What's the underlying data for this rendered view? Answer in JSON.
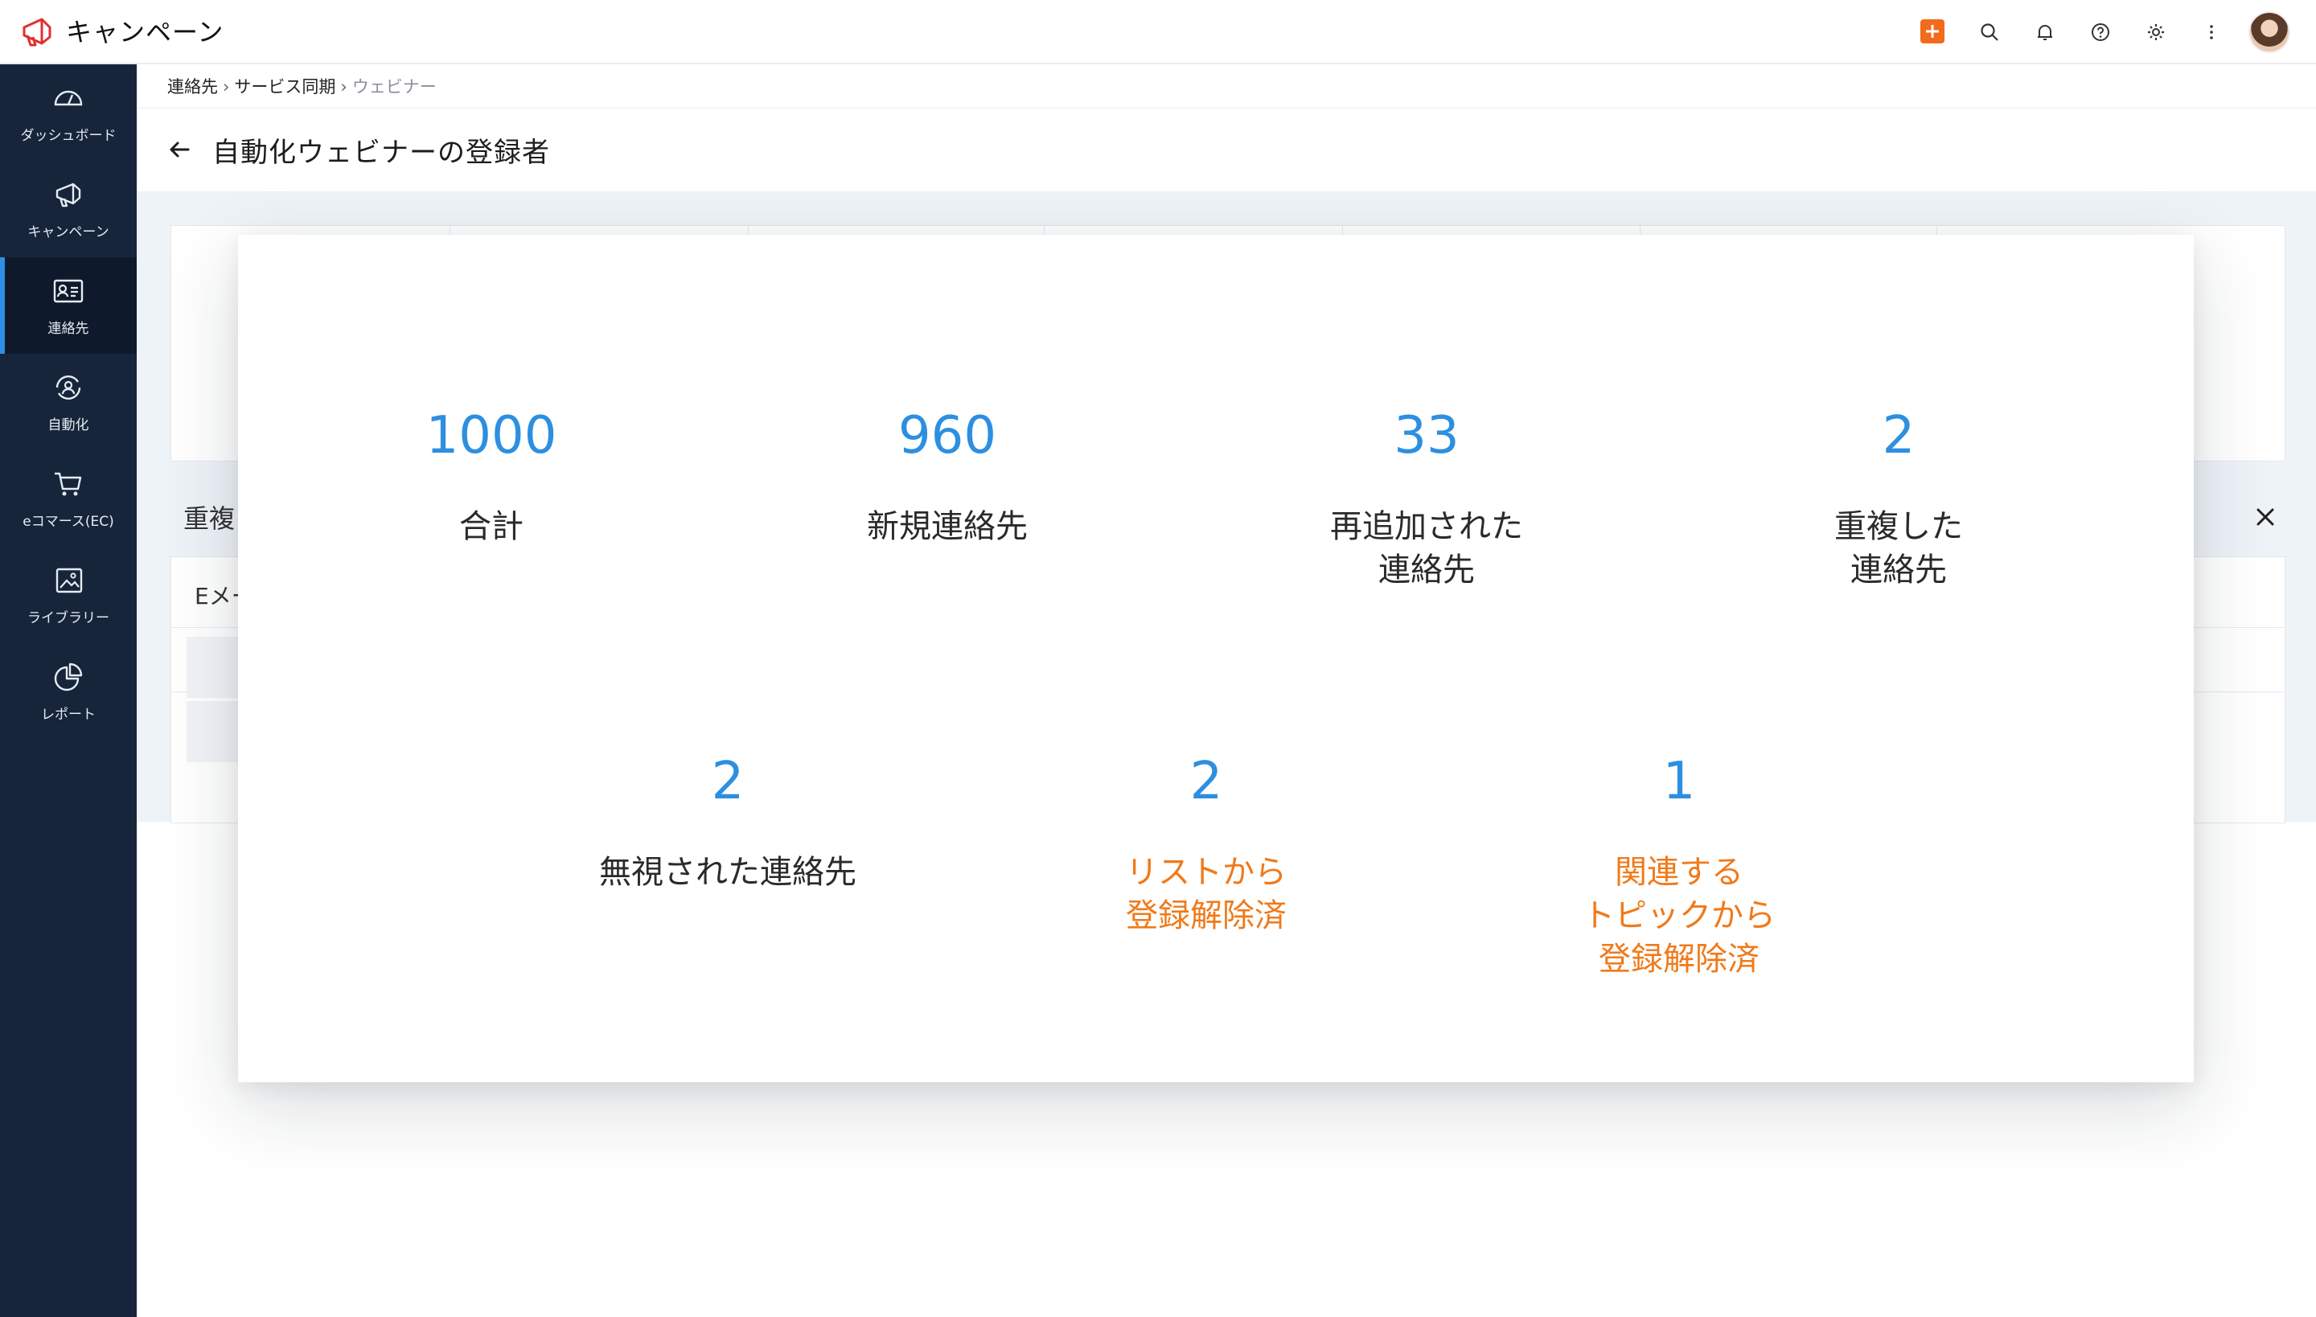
{
  "header": {
    "app_title": "キャンペーン",
    "icons": [
      "plus-icon",
      "search-icon",
      "bell-icon",
      "help-icon",
      "gear-icon",
      "more-icon"
    ],
    "accent_color": "#f26a1b"
  },
  "sidebar": {
    "items": [
      {
        "label": "ダッシュボード",
        "icon": "dashboard-icon"
      },
      {
        "label": "キャンペーン",
        "icon": "megaphone-icon"
      },
      {
        "label": "連絡先",
        "icon": "contact-card-icon",
        "active": true
      },
      {
        "label": "自動化",
        "icon": "automation-icon"
      },
      {
        "label": "eコマース(EC)",
        "icon": "cart-icon"
      },
      {
        "label": "ライブラリー",
        "icon": "library-icon"
      },
      {
        "label": "レポート",
        "icon": "report-icon"
      }
    ]
  },
  "breadcrumb": {
    "items": [
      "連絡先",
      "サービス同期",
      "ウェビナー"
    ]
  },
  "page": {
    "title": "自動化ウェビナーの登録者"
  },
  "background": {
    "dup_section_label": "重複",
    "table_first_header": "Eメー"
  },
  "summary": {
    "stats": [
      {
        "value": "1000",
        "label": "合計"
      },
      {
        "value": "960",
        "label": "新規連絡先"
      },
      {
        "value": "33",
        "label": "再追加された\n連絡先"
      },
      {
        "value": "2",
        "label": "重複した\n連絡先"
      },
      {
        "value": "2",
        "label": "無視された連絡先"
      },
      {
        "value": "2",
        "label": "リストから\n登録解除済"
      },
      {
        "value": "1",
        "label": "関連する\nトピックから\n登録解除済"
      }
    ],
    "colors": {
      "number": "#2d8fe0",
      "warning_label": "#f07a1a"
    }
  }
}
